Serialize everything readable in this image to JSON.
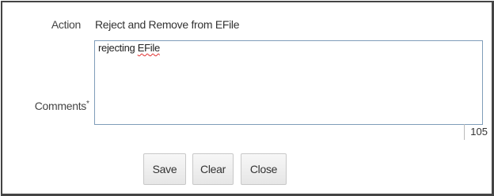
{
  "form": {
    "action_label": "Action",
    "action_value": "Reject and Remove from EFile",
    "comments_label": "Comments",
    "required_marker": "*",
    "comments_text_prefix": "rejecting ",
    "comments_text_flagged": "EFile",
    "char_counter": "105"
  },
  "buttons": {
    "save_label": "Save",
    "clear_label": "Clear",
    "close_label": "Close"
  },
  "colors": {
    "frame_border": "#444444",
    "textarea_border": "#7f9db9",
    "spellcheck_underline": "#e03030"
  }
}
